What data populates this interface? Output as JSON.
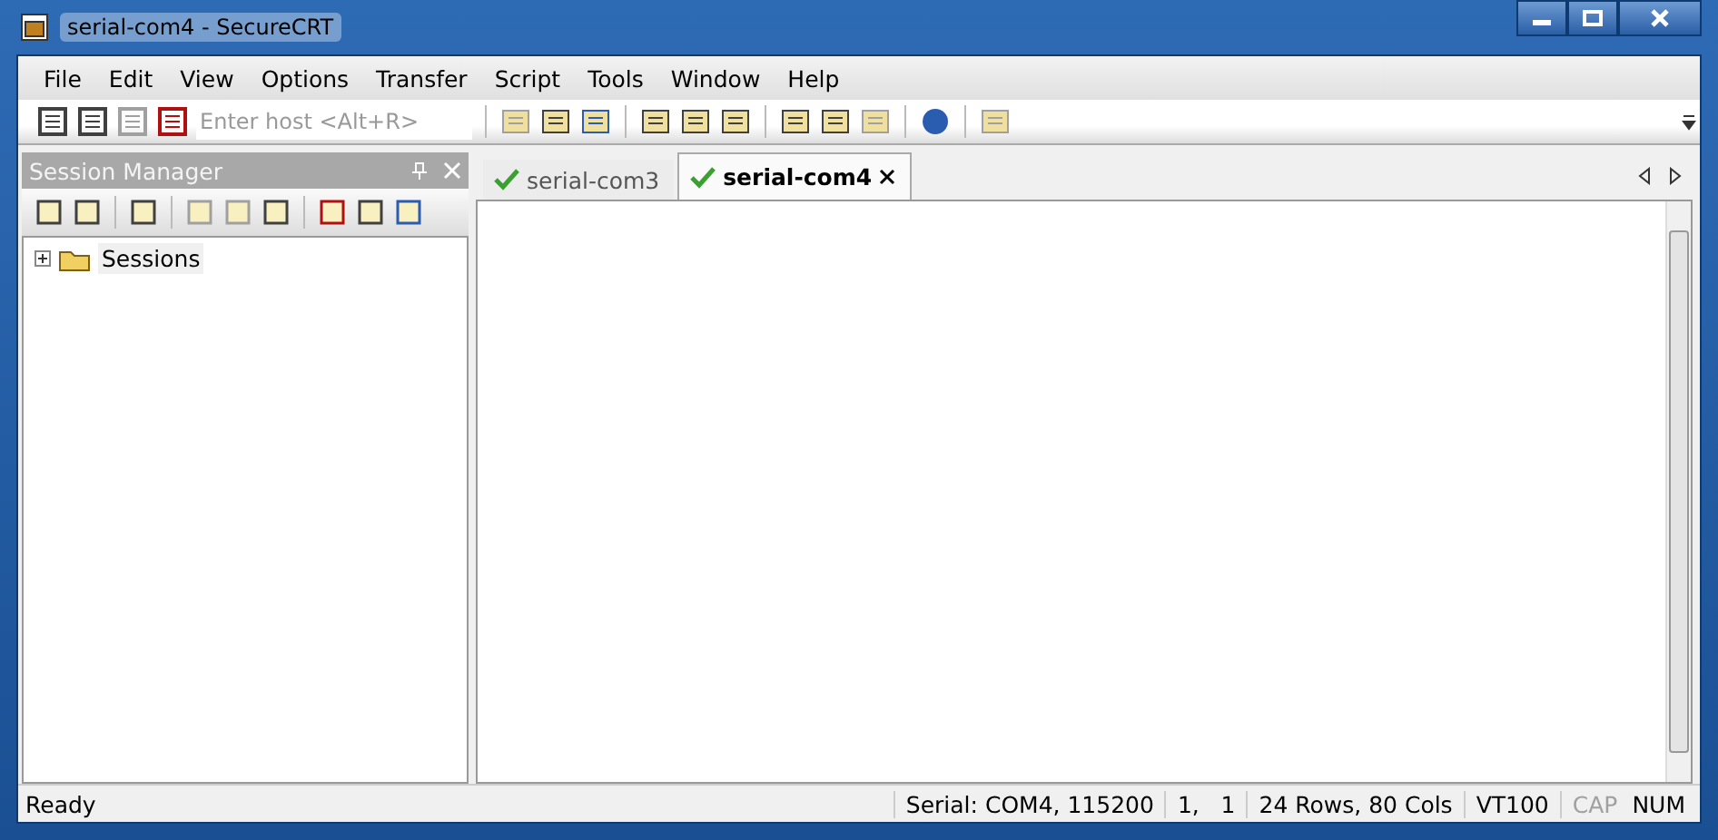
{
  "window": {
    "title": "serial-com4 - SecureCRT"
  },
  "menu": [
    "File",
    "Edit",
    "View",
    "Options",
    "Transfer",
    "Script",
    "Tools",
    "Window",
    "Help"
  ],
  "toolbar": {
    "host_field": {
      "placeholder": "Enter host <Alt+R>"
    }
  },
  "session_manager": {
    "title": "Session Manager",
    "tree": [
      {
        "label": "Sessions",
        "expanded": false
      }
    ]
  },
  "tabs": [
    {
      "label": "serial-com3",
      "selected": false
    },
    {
      "label": "serial-com4",
      "selected": true
    }
  ],
  "status_bar": [
    {
      "text": "Ready",
      "disabled": false
    },
    {
      "text": "Serial: COM4, 115200",
      "disabled": false
    },
    {
      "text": "1,   1",
      "disabled": false
    },
    {
      "text": "24 Rows, 80 Cols",
      "disabled": false
    },
    {
      "text": "VT100",
      "disabled": false
    },
    {
      "text": "CAP",
      "disabled": true
    },
    {
      "text": "NUM",
      "disabled": false
    }
  ]
}
